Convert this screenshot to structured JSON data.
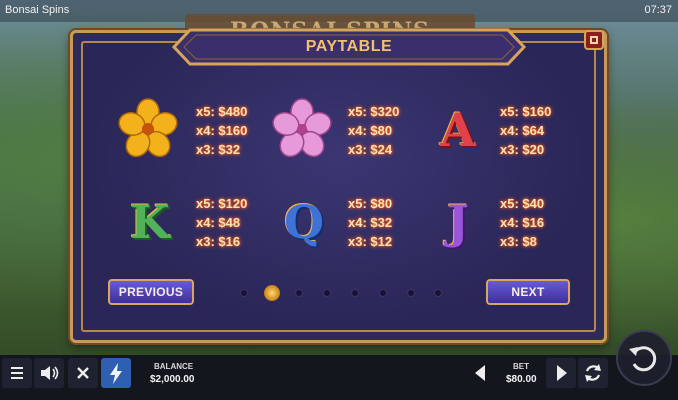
{
  "header": {
    "game_title": "Bonsai Spins",
    "clock": "07:37",
    "logo_text": "BONSAI SPINS"
  },
  "paytable": {
    "title": "PAYTABLE",
    "symbols": [
      {
        "name": "yellow-flower",
        "pays": [
          "x5: $480",
          "x4: $160",
          "x3: $32"
        ]
      },
      {
        "name": "pink-flower",
        "pays": [
          "x5: $320",
          "x4: $80",
          "x3: $24"
        ]
      },
      {
        "name": "A",
        "pays": [
          "x5: $160",
          "x4: $64",
          "x3: $20"
        ]
      },
      {
        "name": "K",
        "pays": [
          "x5: $120",
          "x4: $48",
          "x3: $16"
        ]
      },
      {
        "name": "Q",
        "pays": [
          "x5: $80",
          "x4: $32",
          "x3: $12"
        ]
      },
      {
        "name": "J",
        "pays": [
          "x5: $40",
          "x4: $16",
          "x3: $8"
        ]
      }
    ],
    "previous_label": "PREVIOUS",
    "next_label": "NEXT",
    "pages_total": 8,
    "current_page": 2
  },
  "bottom_bar": {
    "menu_icon": "hamburger-icon",
    "sound_icon": "speaker-icon",
    "close_icon": "x-icon",
    "turbo_icon": "lightning-icon",
    "balance_label": "BALANCE",
    "balance_value": "$2,000.00",
    "bet_label": "BET",
    "bet_value": "$80.00",
    "autoplay_icon": "refresh-icon"
  },
  "colors": {
    "panel": "#2e2a5a",
    "gold_frame": "#c89a5a",
    "payout_glow": "#ff6a1a",
    "button_purple": "#5a4acb"
  }
}
